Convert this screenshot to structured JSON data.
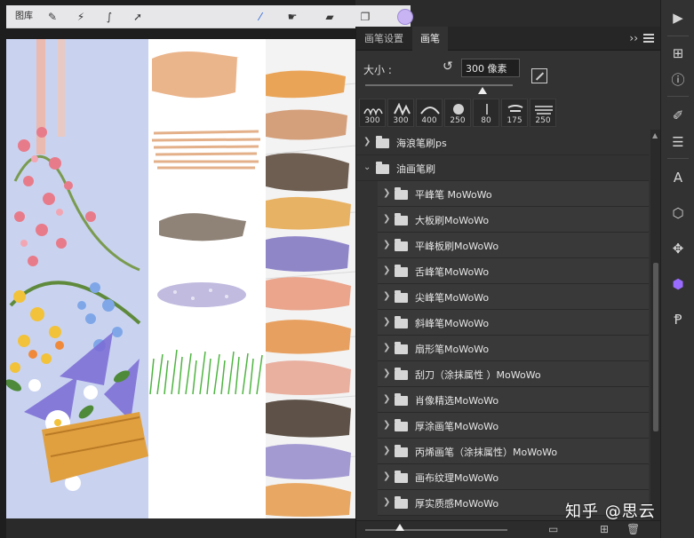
{
  "procreate": {
    "toolbar": {
      "gallery_label": "图库"
    }
  },
  "panel": {
    "tabs": [
      {
        "label": "画笔设置"
      },
      {
        "label": "画笔"
      }
    ],
    "collapse_glyph": "››",
    "size": {
      "label": "大小 :",
      "value": "300 像素"
    },
    "presets": [
      {
        "value": "300"
      },
      {
        "value": "300"
      },
      {
        "value": "400"
      },
      {
        "value": "250"
      },
      {
        "value": "80"
      },
      {
        "value": "175"
      },
      {
        "value": "250"
      }
    ],
    "tree": [
      {
        "label": "海浪笔刷ps",
        "level": 0,
        "expanded": false
      },
      {
        "label": "油画笔刷",
        "level": 0,
        "expanded": true
      },
      {
        "label": "平峰笔 MoWoWo",
        "level": 1
      },
      {
        "label": "大板刷MoWoWo",
        "level": 1
      },
      {
        "label": "平峰板刷MoWoWo",
        "level": 1
      },
      {
        "label": "舌峰笔MoWoWo",
        "level": 1
      },
      {
        "label": "尖峰笔MoWoWo",
        "level": 1
      },
      {
        "label": "斜峰笔MoWoWo",
        "level": 1
      },
      {
        "label": "扇形笔MoWoWo",
        "level": 1
      },
      {
        "label": "刮刀（涂抹属性 ）MoWoWo",
        "level": 1
      },
      {
        "label": "肖像精选MoWoWo",
        "level": 1
      },
      {
        "label": "厚涂画笔MoWoWo",
        "level": 1
      },
      {
        "label": "丙烯画笔（涂抹属性）MoWoWo",
        "level": 1
      },
      {
        "label": "画布纹理MoWoWo",
        "level": 1
      },
      {
        "label": "厚实质感MoWoWo",
        "level": 1
      }
    ]
  },
  "watermark": "知乎 @思云",
  "colors": {
    "accent_blue": "#2f68d8",
    "panel_bg": "#323232",
    "selected_color": "#c8b4f2"
  }
}
